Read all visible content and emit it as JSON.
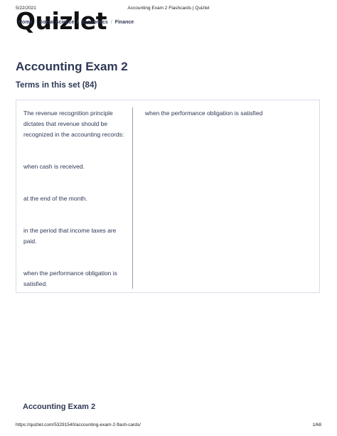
{
  "print_header": {
    "date": "5/22/2021",
    "title": "Accounting Exam 2 Flashcards | Quizlet"
  },
  "logo": "Quizlet",
  "breadcrumb": [
    "Home",
    "Social Science",
    "Economics",
    "Finance"
  ],
  "page_title": "Accounting Exam 2",
  "terms_heading": "Terms in this set (84)",
  "card": {
    "term": {
      "question": "The revenue recognition principle dictates that revenue should be recognized in the accounting records:",
      "options": [
        "when cash is received.",
        "at the end of the month.",
        "in the period that income taxes are paid.",
        "when the performance obligation is satisfied."
      ]
    },
    "definition": "when the performance obligation is satisfied"
  },
  "footer_heading": "Accounting Exam 2",
  "print_footer": {
    "url": "https://quizlet.com/53291540/accounting-exam-2-flash-cards/",
    "page": "1/68"
  }
}
